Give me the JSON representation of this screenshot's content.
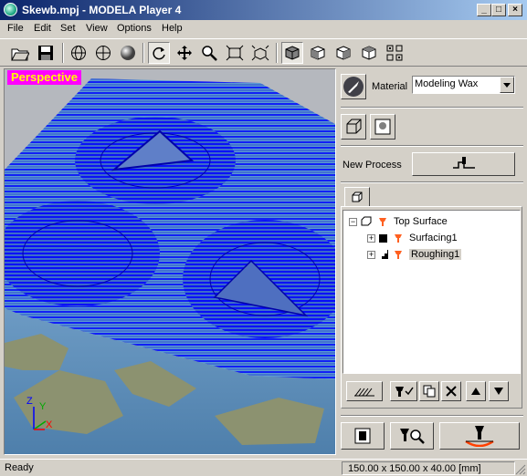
{
  "window": {
    "title": "Skewb.mpj - MODELA Player 4",
    "minimize": "_",
    "maximize": "□",
    "close": "×"
  },
  "menu": [
    "File",
    "Edit",
    "Set",
    "View",
    "Options",
    "Help"
  ],
  "toolbar": {
    "buttons": [
      "open-icon",
      "save-icon",
      "globe-icon",
      "sphere-wire-icon",
      "sphere-shaded-icon",
      "rotate-icon",
      "pan-icon",
      "zoom-icon",
      "fit-icon",
      "zoom-extents-icon",
      "view-iso-icon",
      "view-front-icon",
      "view-right-icon",
      "view-back-icon",
      "view-grid-icon"
    ]
  },
  "viewport": {
    "label": "Perspective",
    "axes": {
      "z": "Z",
      "y": "Y",
      "x": "X"
    },
    "colors": {
      "toolpath": "#0000ff",
      "stock": "#6d9bc4",
      "surface": "#8c9270"
    }
  },
  "panel": {
    "material_label": "Material",
    "material_value": "Modeling Wax",
    "new_process_label": "New Process",
    "tree": {
      "root": "Top Surface",
      "children": [
        {
          "label": "Surfacing1",
          "expander": "+"
        },
        {
          "label": "Roughing1",
          "expander": "+"
        }
      ],
      "root_expander": "−"
    }
  },
  "status": {
    "left": "Ready",
    "right": "150.00 x 150.00 x 40.00 [mm]"
  }
}
